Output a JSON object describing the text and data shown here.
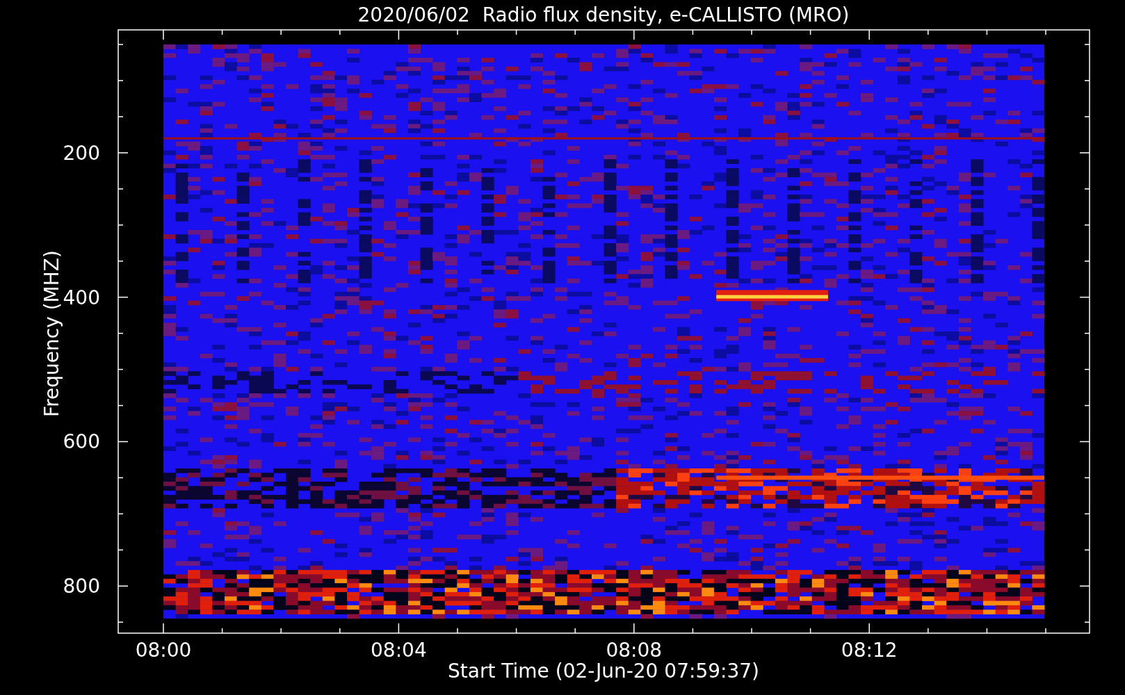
{
  "plot": {
    "title": "2020/06/02  Radio flux density, e-CALLISTO (MRO)",
    "xlabel": "Start Time (02-Jun-20 07:59:37)",
    "ylabel": "Frequency (MHZ)",
    "xticks": [
      "08:00",
      "08:04",
      "08:08",
      "08:12"
    ],
    "yticks": [
      "200",
      "400",
      "600",
      "800"
    ]
  }
}
